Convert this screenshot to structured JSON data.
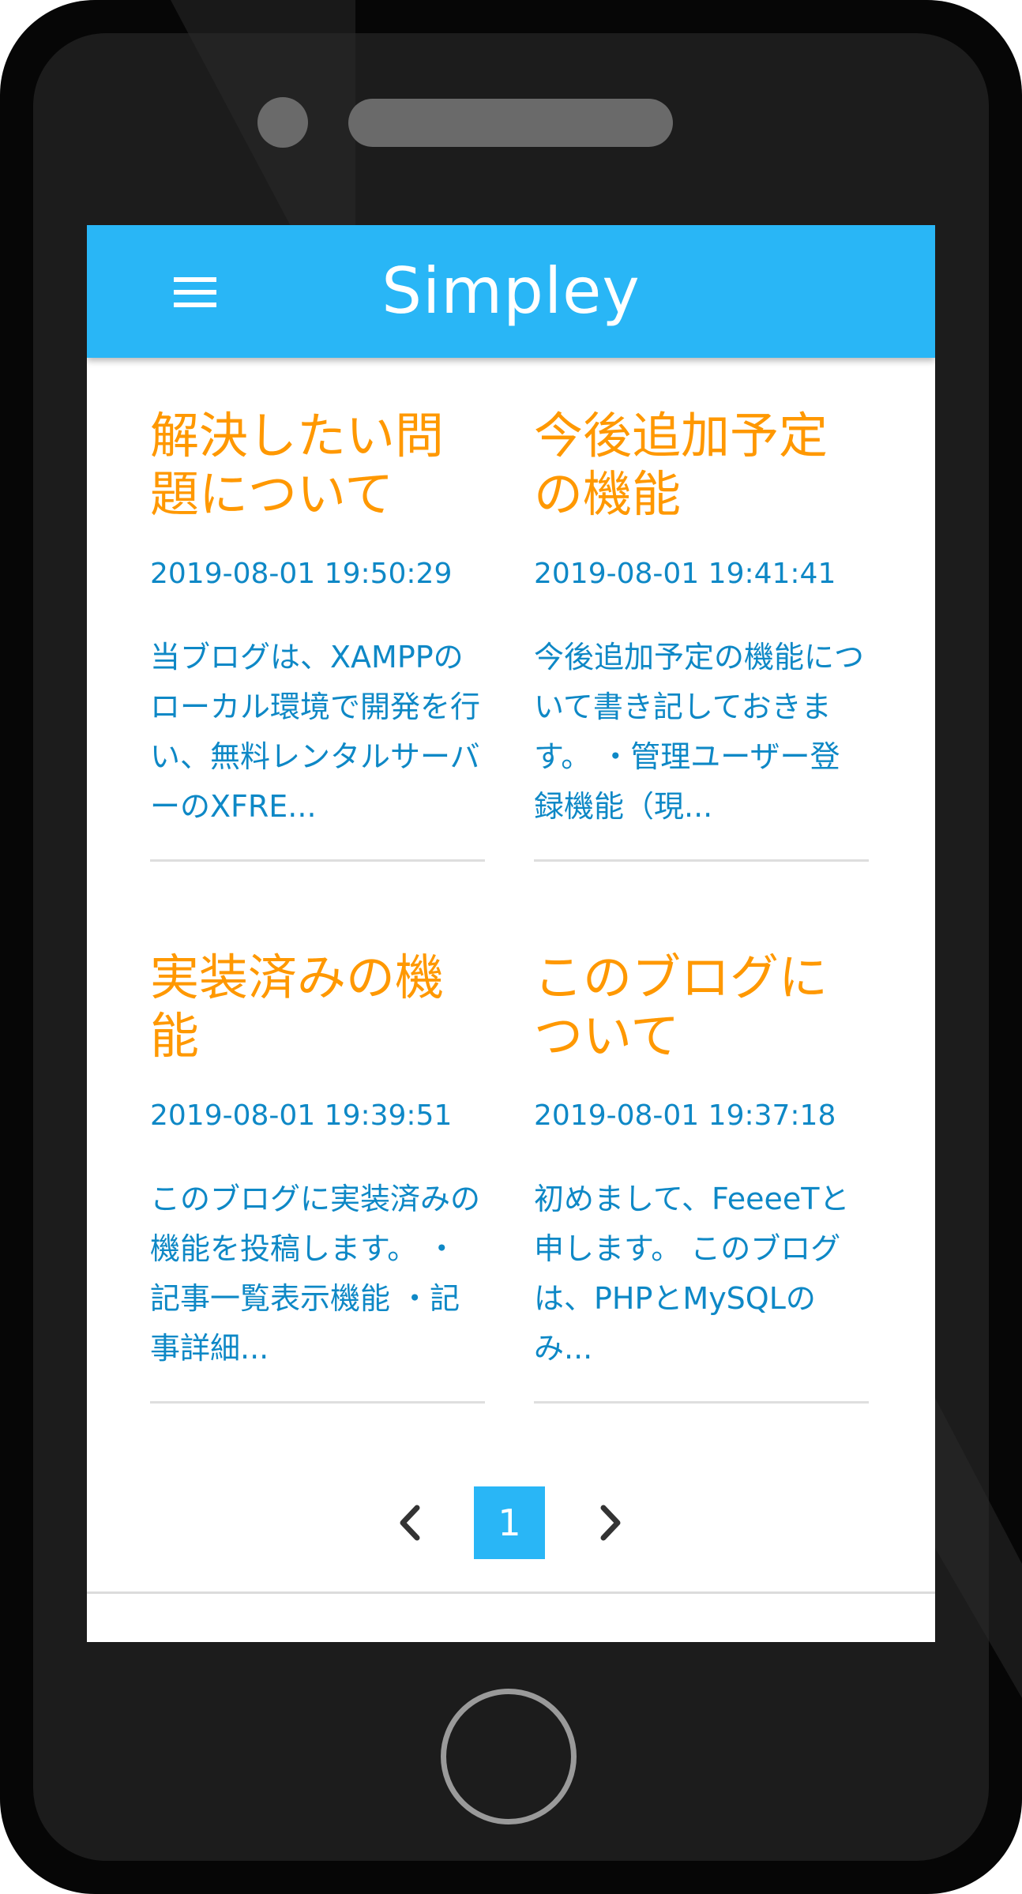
{
  "app": {
    "title": "Simpley",
    "menu_icon": "hamburger-menu-icon",
    "accent_color": "#29b6f6",
    "title_color": "#ff9800",
    "text_color": "#0e88c6"
  },
  "posts": [
    {
      "title": "解決したい問題について",
      "date": "2019-08-01 19:50:29",
      "excerpt": "当ブログは、XAMPPのローカル環境で開発を行い、無料レンタルサーバーのXFRE..."
    },
    {
      "title": "今後追加予定の機能",
      "date": "2019-08-01 19:41:41",
      "excerpt": "今後追加予定の機能について書き記しておきます。 ・管理ユーザー登録機能（現..."
    },
    {
      "title": "実装済みの機能",
      "date": "2019-08-01 19:39:51",
      "excerpt": "このブログに実装済みの機能を投稿します。 ・記事一覧表示機能 ・記事詳細..."
    },
    {
      "title": "このブログについて",
      "date": "2019-08-01 19:37:18",
      "excerpt": "初めまして、FeeeeTと申します。 このブログは、PHPとMySQLのみ..."
    }
  ],
  "pagination": {
    "prev_icon": "chevron-left-icon",
    "current_page": "1",
    "next_icon": "chevron-right-icon"
  }
}
